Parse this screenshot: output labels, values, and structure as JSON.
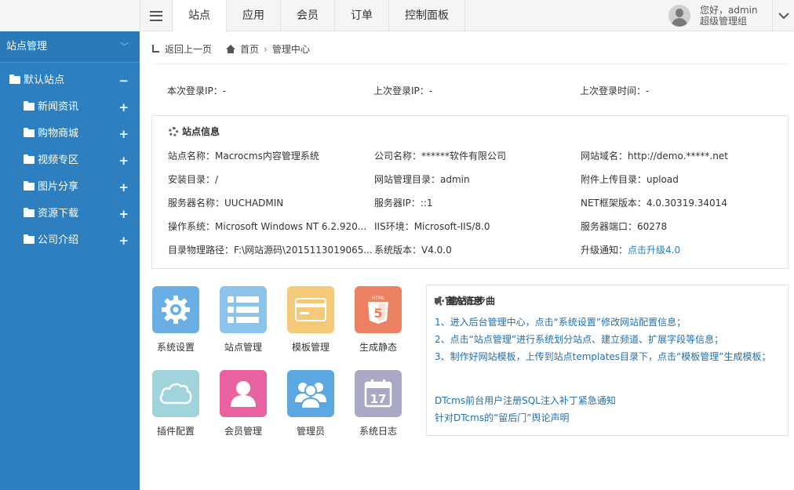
{
  "header": {
    "nav": [
      "站点",
      "应用",
      "会员",
      "订单",
      "控制面板"
    ],
    "active_nav": "站点",
    "user_greeting": "您好，admin",
    "user_role": "超级管理组"
  },
  "sidebar": {
    "title": "站点管理",
    "root": {
      "label": "默认站点",
      "op": "−"
    },
    "items": [
      {
        "label": "新闻资讯",
        "op": "+"
      },
      {
        "label": "购物商城",
        "op": "+"
      },
      {
        "label": "视频专区",
        "op": "+"
      },
      {
        "label": "图片分享",
        "op": "+"
      },
      {
        "label": "资源下载",
        "op": "+"
      },
      {
        "label": "公司介绍",
        "op": "+"
      }
    ]
  },
  "breadcrumb": {
    "back": "返回上一页",
    "home": "首页",
    "current": "管理中心"
  },
  "login": {
    "this_ip": "本次登录IP：-",
    "last_ip": "上次登录IP：-",
    "last_time": "上次登录时间：-"
  },
  "site_info": {
    "title": "站点信息",
    "rows": [
      [
        "站点名称：Macrocms内容管理系统",
        "公司名称：******软件有限公司",
        "网站域名：http://demo.*****.net"
      ],
      [
        "安装目录：/",
        "网站管理目录：admin",
        "附件上传目录：upload"
      ],
      [
        "服务器名称：UUCHADMIN",
        "服务器IP：::1",
        "NET框架版本：4.0.30319.34014"
      ],
      [
        "操作系统：Microsoft Windows NT 6.2.920...",
        "IIS环境：Microsoft-IIS/8.0",
        "服务器端口：60278"
      ],
      [
        "目录物理路径：F:\\网站源码\\2015113019065...",
        "系统版本：V4.0.0",
        "升级通知："
      ]
    ],
    "upgrade_link": "点击升级4.0"
  },
  "tiles": [
    {
      "label": "系统设置",
      "color": "#6aaee6",
      "icon": "gear-icon"
    },
    {
      "label": "站点管理",
      "color": "#8cc3ea",
      "icon": "list-icon"
    },
    {
      "label": "模板管理",
      "color": "#f4c978",
      "icon": "card-icon"
    },
    {
      "label": "生成静态",
      "color": "#ec8062",
      "icon": "html5-icon"
    },
    {
      "label": "插件配置",
      "color": "#9fd4dc",
      "icon": "cloud-icon"
    },
    {
      "label": "会员管理",
      "color": "#e8629f",
      "icon": "user-icon"
    },
    {
      "label": "管理员",
      "color": "#5aa7e2",
      "icon": "users-icon"
    },
    {
      "label": "系统日志",
      "color": "#a9a9c5",
      "icon": "calendar-icon"
    }
  ],
  "steps": {
    "title": "建站三步曲",
    "items": [
      "1、进入后台管理中心，点击“系统设置”修改网站配置信息；",
      "2、点击“站点管理”进行系统划分站点、建立频道、扩展字段等信息；",
      "3、制作好网站模板，上传到站点templates目录下，点击“模板管理”生成模板；"
    ]
  },
  "news": {
    "title": "官方消息",
    "items": [
      "DTcms前台用户注册SQL注入补丁紧急通知",
      "针对DTcms的“留后门”舆论声明"
    ]
  }
}
